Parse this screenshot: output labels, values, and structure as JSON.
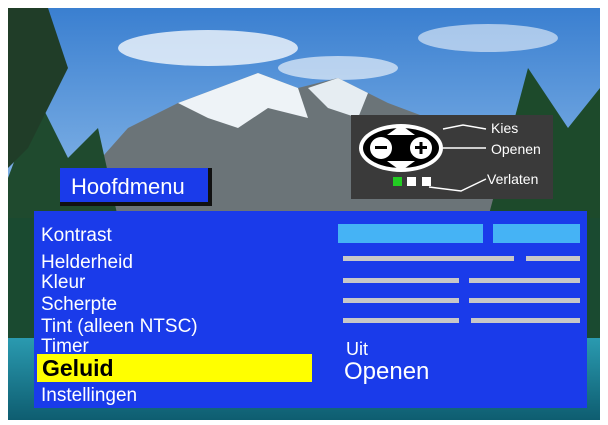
{
  "remote_help": {
    "select_label": "Kies",
    "open_label": "Openen",
    "exit_label": "Verlaten",
    "icons": [
      "up-arrow-icon",
      "down-arrow-icon",
      "minus-icon",
      "plus-icon"
    ],
    "indicator_colors": [
      "#22cc22",
      "#ffffff",
      "#ffffff"
    ]
  },
  "menu": {
    "title": "Hoofdmenu",
    "items": [
      {
        "label": "Kontrast"
      },
      {
        "label": "Helderheid"
      },
      {
        "label": "Kleur"
      },
      {
        "label": "Scherpte"
      },
      {
        "label": "Tint (alleen NTSC)"
      },
      {
        "label": "Timer",
        "value": "Uit"
      },
      {
        "label": "Geluid",
        "value": "Openen",
        "selected": true
      },
      {
        "label": "Instellingen"
      }
    ]
  },
  "colors": {
    "menu_blue": "#1a3bea",
    "highlight": "#ffff00",
    "slider_active": "#45b3f5",
    "slider_inactive": "#c8c8c8"
  }
}
